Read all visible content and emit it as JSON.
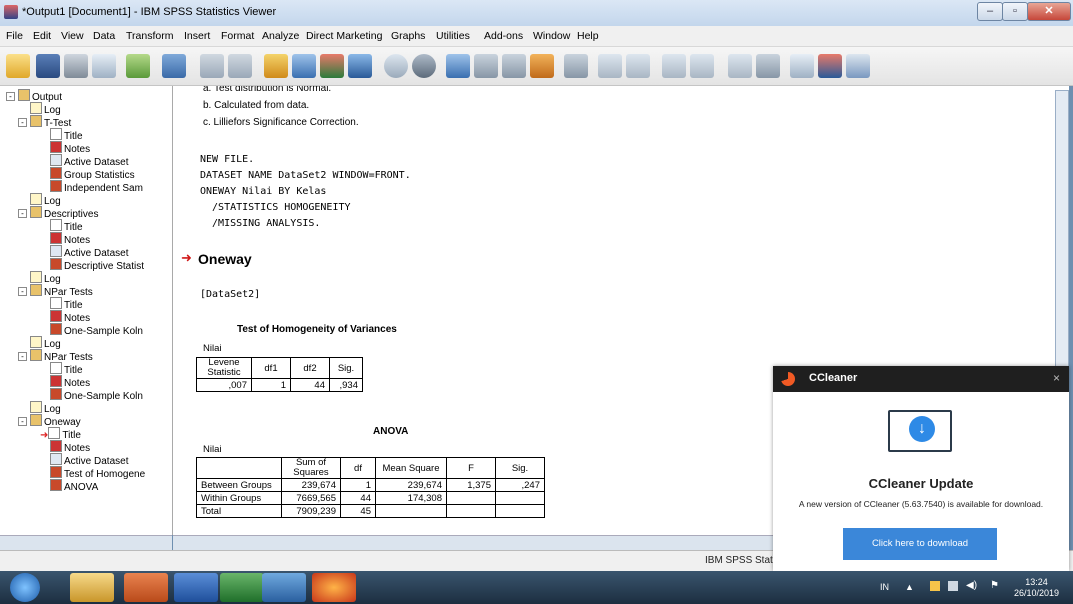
{
  "window": {
    "title": "*Output1 [Document1] - IBM SPSS Statistics Viewer",
    "min": "–",
    "max": "▫",
    "close": "✕"
  },
  "menu": [
    "File",
    "Edit",
    "View",
    "Data",
    "Transform",
    "Insert",
    "Format",
    "Analyze",
    "Direct Marketing",
    "Graphs",
    "Utilities",
    "Add-ons",
    "Window",
    "Help"
  ],
  "outline": {
    "nodes": [
      "Output",
      "Log",
      "T-Test",
      "Title",
      "Notes",
      "Active Dataset",
      "Group Statistics",
      "Independent Sam",
      "Log",
      "Descriptives",
      "Title",
      "Notes",
      "Active Dataset",
      "Descriptive Statist",
      "Log",
      "NPar Tests",
      "Title",
      "Notes",
      "One-Sample Koln",
      "Log",
      "NPar Tests",
      "Title",
      "Notes",
      "One-Sample Koln",
      "Log",
      "Oneway",
      "Title",
      "Notes",
      "Active Dataset",
      "Test of Homogene",
      "ANOVA"
    ]
  },
  "content": {
    "footnote_a": "a. Test distribution is Normal.",
    "footnote_b": "b. Calculated from data.",
    "footnote_c": "c. Lilliefors Significance Correction.",
    "syntax": [
      "NEW FILE.",
      "DATASET NAME DataSet2 WINDOW=FRONT.",
      "ONEWAY Nilai BY Kelas",
      "  /STATISTICS HOMOGENEITY",
      "  /MISSING ANALYSIS."
    ],
    "section_title": "Oneway",
    "dataset_label": "[DataSet2]",
    "homog": {
      "title": "Test of Homogeneity of Variances",
      "var": "Nilai",
      "headers": [
        "Levene Statistic",
        "df1",
        "df2",
        "Sig."
      ],
      "values": [
        ",007",
        "1",
        "44",
        ",934"
      ]
    },
    "anova": {
      "title": "ANOVA",
      "var": "Nilai",
      "headers": [
        "",
        "Sum of Squares",
        "df",
        "Mean Square",
        "F",
        "Sig."
      ],
      "rows": [
        [
          "Between Groups",
          "239,674",
          "1",
          "239,674",
          "1,375",
          ",247"
        ],
        [
          "Within Groups",
          "7669,565",
          "44",
          "174,308",
          "",
          ""
        ],
        [
          "Total",
          "7909,239",
          "45",
          "",
          "",
          ""
        ]
      ]
    }
  },
  "status": "IBM SPSS Stati",
  "ccleaner": {
    "app_name": "CCleaner",
    "close": "×",
    "title": "CCleaner Update",
    "message": "A new version of CCleaner (5.63.7540) is available for download.",
    "button": "Click here to download"
  },
  "taskbar": {
    "lang": "IN",
    "time": "13:24",
    "date": "26/10/2019"
  }
}
